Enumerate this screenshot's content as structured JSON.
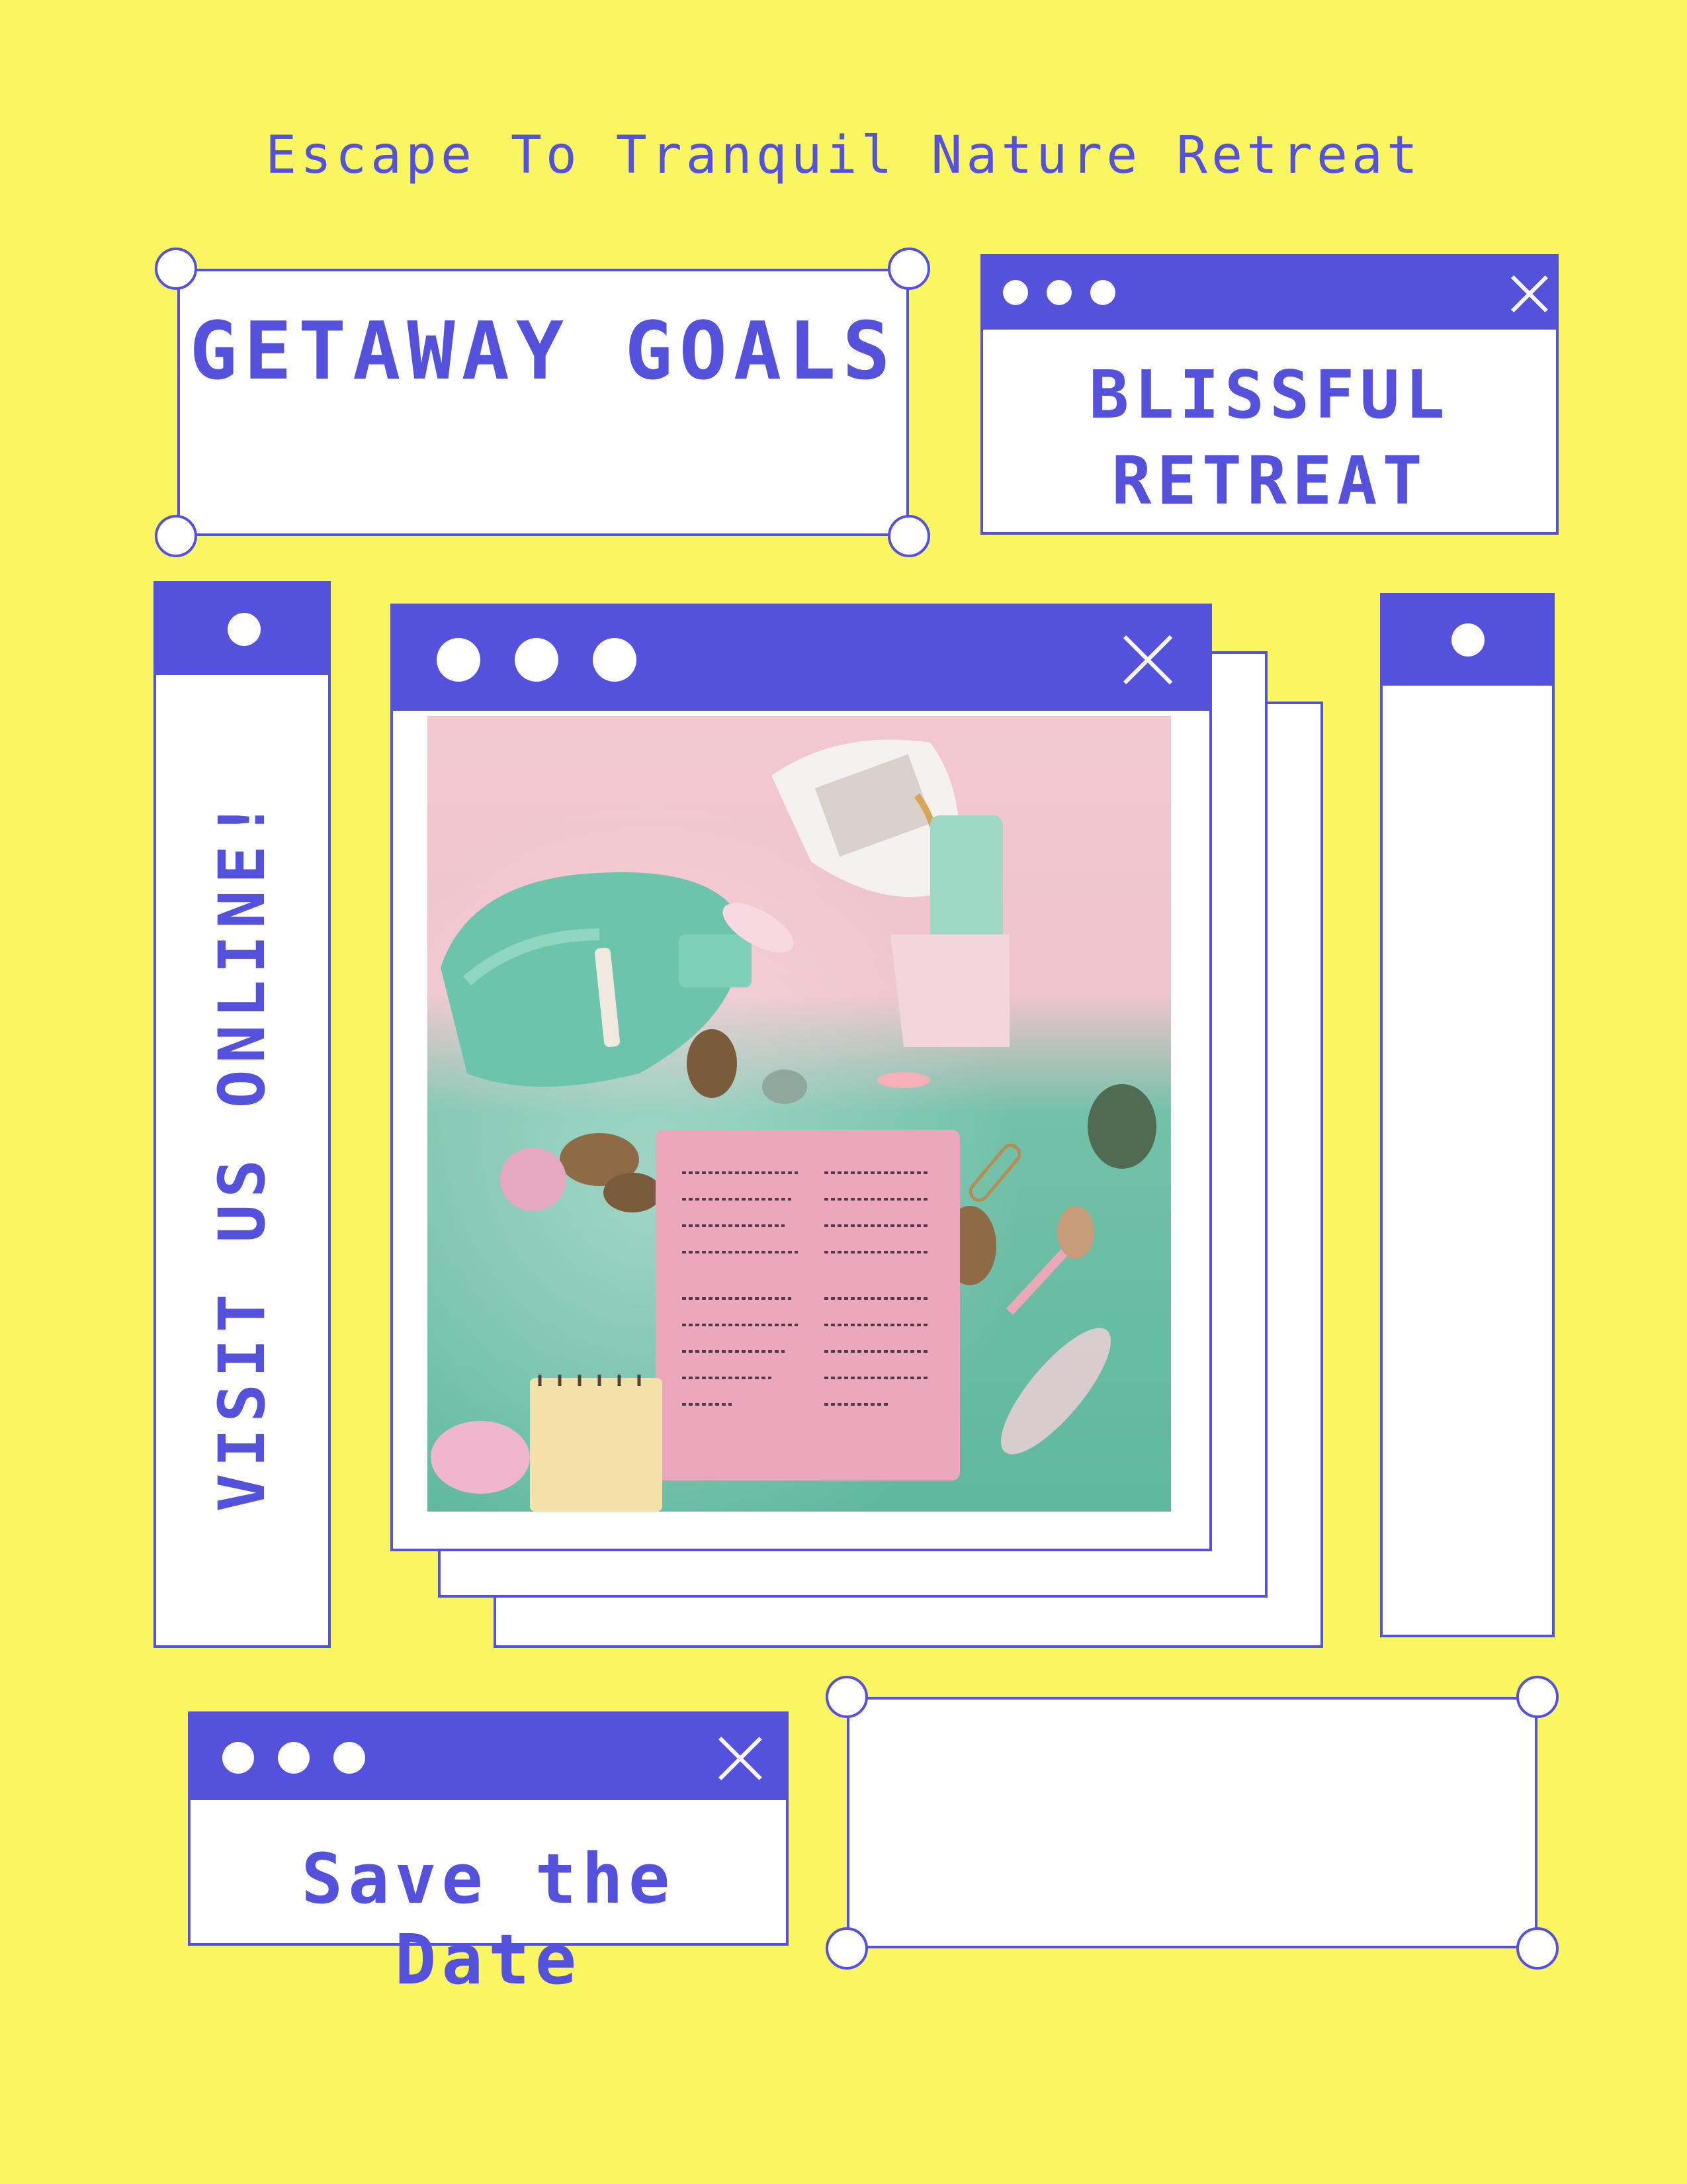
{
  "headline": "Escape To Tranquil Nature Retreat",
  "getaway": {
    "title": "GETAWAY GOALS"
  },
  "blissful": {
    "line1": "BLISSFUL",
    "line2": "RETREAT"
  },
  "side": {
    "vertical_text": "VISIT US ONLINE!"
  },
  "save": {
    "text": "Save the Date"
  },
  "colors": {
    "background": "#F9F662",
    "accent": "#5452DD",
    "panel": "#FFFFFF"
  },
  "icons": [
    "window-dot-icon",
    "close-icon",
    "selection-handle-icon"
  ]
}
